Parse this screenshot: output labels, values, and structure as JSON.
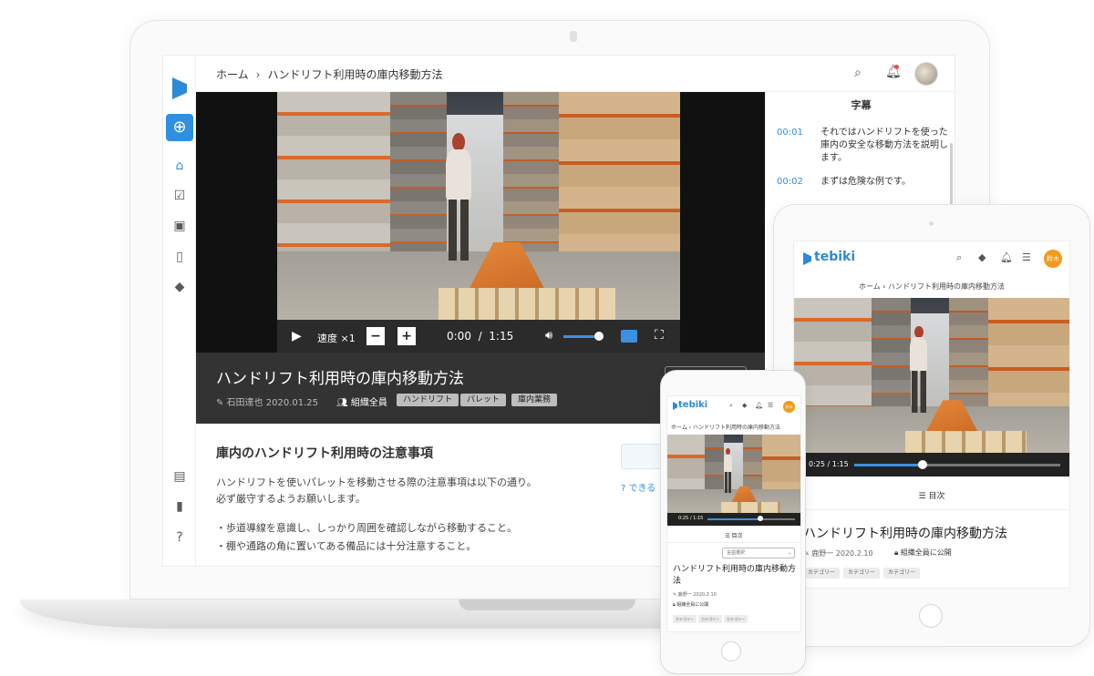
{
  "laptop": {
    "breadcrumb": {
      "home": "ホーム",
      "current": "ハンドリフト利用時の庫内移動方法"
    },
    "sidebar": {
      "add_icon": "plus-circle-icon",
      "nav_icons": [
        "home-icon",
        "calendar-check-icon",
        "video-library-icon",
        "book-icon",
        "tag-icon",
        "building-icon",
        "bar-chart-icon",
        "help-icon"
      ]
    },
    "player": {
      "speed_label": "速度 ×1",
      "current_time": "0:00",
      "time_sep": "/",
      "duration": "1:15",
      "volume": 0.85
    },
    "transcript": {
      "title": "字幕",
      "rows": [
        {
          "time": "00:01",
          "text": "それではハンドリフトを使った庫内の安全な移動方法を説明します。"
        },
        {
          "time": "00:02",
          "text": "まずは危険な例です。"
        }
      ]
    },
    "video_info": {
      "title": "ハンドリフト利用時の庫内移動方法",
      "author_date": "石田達也 2020.01.25",
      "scope": "組織全員",
      "tags": [
        "ハンドリフト",
        "パレット",
        "庫内業務"
      ]
    },
    "description": {
      "heading": "庫内のハンドリフト利用時の注意事項",
      "intro": "ハンドリフトを使いパレットを移動させる際の注意事項は以下の通り。",
      "intro2": "必ず厳守するようお願いします。",
      "bullet1": "・歩道導線を意識し、しっかり周囲を確認しながら移動すること。",
      "bullet2": "・棚や通路の角に置いてある備品には十分注意すること。",
      "aside_link": "できる"
    }
  },
  "tablet": {
    "logo": "tebiki",
    "avatar": "鈴木",
    "breadcrumb": "ホーム  ›  ハンドリフト利用時の庫内移動方法",
    "player_time": "0:25 / 1:15",
    "progress": 0.33,
    "toc_label": "目次",
    "title": "ハンドリフト利用時の庫内移動方法",
    "author_date": "鹿野一 2020.2.10",
    "scope": "組織全員に公開",
    "tags": [
      "カテゴリー",
      "カテゴリー",
      "カテゴリー"
    ]
  },
  "phone": {
    "logo": "tebiki",
    "avatar": "鈴木",
    "breadcrumb": "ホーム › ハンドリフト利用時の庫内移動方法",
    "player_time": "0:25 / 1:15",
    "progress": 0.6,
    "toc_label": "目次",
    "select_value": "言語選択",
    "title": "ハンドリフト利用時の庫内移動方法",
    "author_date": "鹿野一  2020.2.10",
    "scope": "組織全員に公開",
    "tags": [
      "カテゴリー",
      "カテゴリー",
      "カテゴリー"
    ]
  },
  "colors": {
    "accent": "#2f8fe0",
    "avatar": "#f29a1c",
    "notification": "#e5533d"
  }
}
